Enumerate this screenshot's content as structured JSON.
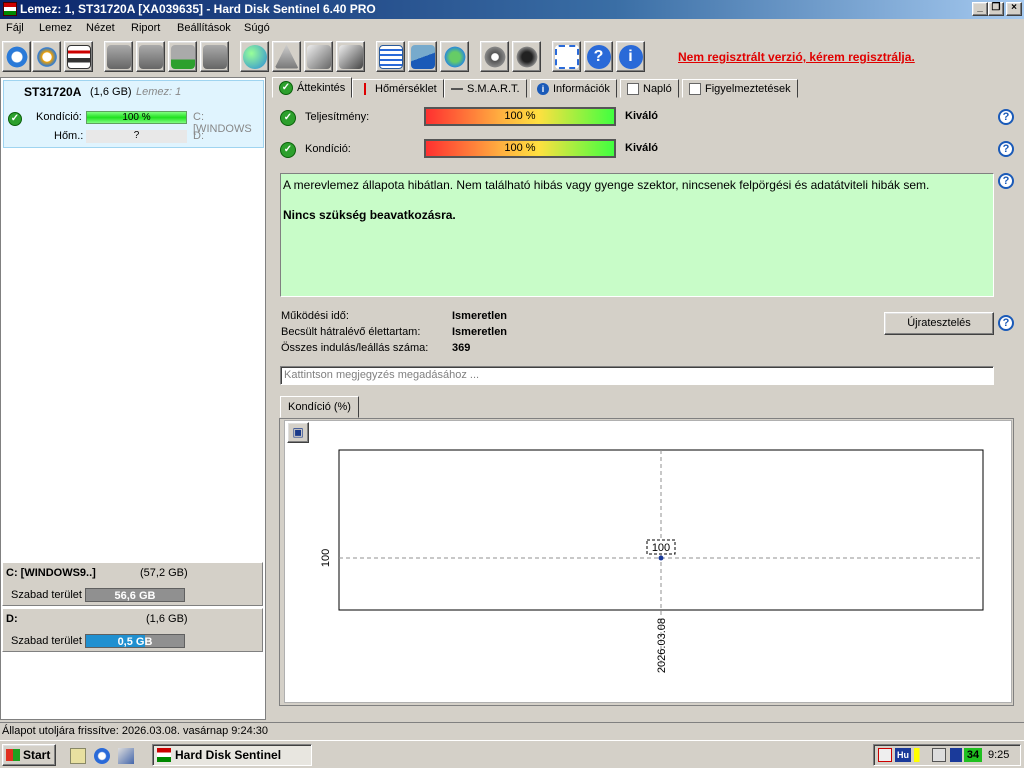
{
  "window": {
    "title": "Lemez: 1, ST31720A [XA039635]  -  Hard Disk Sentinel 6.40 PRO"
  },
  "menu": [
    "Fájl",
    "Lemez",
    "Nézet",
    "Riport",
    "Beállítások",
    "Súgó"
  ],
  "toolbar": {
    "unregistered": "Nem regisztrált verzió, kérem regisztrálja."
  },
  "disk": {
    "model": "ST31720A",
    "size": "(1,6 GB)",
    "lemez_label": "Lemez: 1",
    "condition_label": "Kondíció:",
    "condition_value": "100 %",
    "condition_pct": 100,
    "vol1": "C: [WINDOWS",
    "temp_label": "Hőm.:",
    "temp_value": "?",
    "vol2": "D:"
  },
  "volumes": [
    {
      "name": "C: [WINDOWS9..]",
      "size": "(57,2 GB)",
      "free_label": "Szabad terület",
      "free": "56,6 GB",
      "color": "#909090"
    },
    {
      "name": "D:",
      "size": "(1,6 GB)",
      "free_label": "Szabad terület",
      "free": "0,5 GB",
      "color": "#2090d0"
    }
  ],
  "tabs": [
    "Áttekintés",
    "Hőmérséklet",
    "S.M.A.R.T.",
    "Információk",
    "Napló",
    "Figyelmeztetések"
  ],
  "overview": {
    "perf_label": "Teljesítmény:",
    "perf_value": "100 %",
    "perf_rating": "Kiváló",
    "cond_label": "Kondíció:",
    "cond_value": "100 %",
    "cond_rating": "Kiváló",
    "message": "A merevlemez állapota hibátlan. Nem található hibás vagy gyenge szektor, nincsenek felpörgési és adatátviteli hibák sem.",
    "message_bold": "Nincs szükség beavatkozásra.",
    "uptime_label": "Működési idő:",
    "uptime_value": "Ismeretlen",
    "life_label": "Becsült hátralévő élettartam:",
    "life_value": "Ismeretlen",
    "starts_label": "Összes indulás/leállás száma:",
    "starts_value": "369",
    "retest": "Újratesztelés",
    "note_placeholder": "Kattintson megjegyzés megadásához ...",
    "chart_tab": "Kondíció  (%)"
  },
  "chart_data": {
    "type": "line",
    "x": [
      "2026.03.08"
    ],
    "series": [
      {
        "values": [
          100
        ]
      }
    ],
    "ylabel_tick": "100",
    "point_label": "100",
    "xtick": "2026.03.08",
    "grid": true
  },
  "status": "Állapot utoljára frissítve: 2026.03.08. vasárnap 9:24:30",
  "taskbar": {
    "start": "Start",
    "task": "Hard Disk Sentinel",
    "lang": "Hu",
    "temp": "34",
    "clock": "9:25"
  }
}
